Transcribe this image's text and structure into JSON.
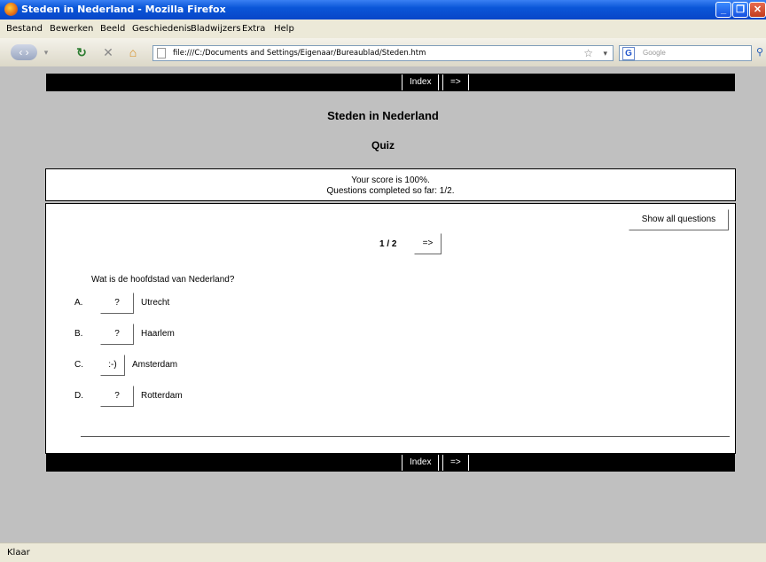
{
  "window": {
    "title": "Steden in Nederland - Mozilla Firefox"
  },
  "menu": [
    "Bestand",
    "Bewerken",
    "Beeld",
    "Geschiedenis",
    "Bladwijzers",
    "Extra",
    "Help"
  ],
  "nav": {
    "url": "file:///C:/Documents and Settings/Eigenaar/Bureaublad/Steden.htm",
    "search_placeholder": "Google"
  },
  "topnav": {
    "index": "Index",
    "next": "=>"
  },
  "page": {
    "title": "Steden in Nederland",
    "subtitle": "Quiz"
  },
  "score": {
    "line1": "Your score is 100%.",
    "line2": "Questions completed so far: 1/2."
  },
  "quiz": {
    "show_all": "Show all questions",
    "counter": "1 / 2",
    "next": "=>",
    "question": "Wat is de hoofdstad van Nederland?",
    "answers": [
      {
        "letter": "A.",
        "mark": "?",
        "text": "Utrecht"
      },
      {
        "letter": "B.",
        "mark": "?",
        "text": "Haarlem"
      },
      {
        "letter": "C.",
        "mark": ":-)",
        "text": "Amsterdam"
      },
      {
        "letter": "D.",
        "mark": "?",
        "text": "Rotterdam"
      }
    ]
  },
  "bottomnav": {
    "index": "Index",
    "next": "=>"
  },
  "status": "Klaar"
}
